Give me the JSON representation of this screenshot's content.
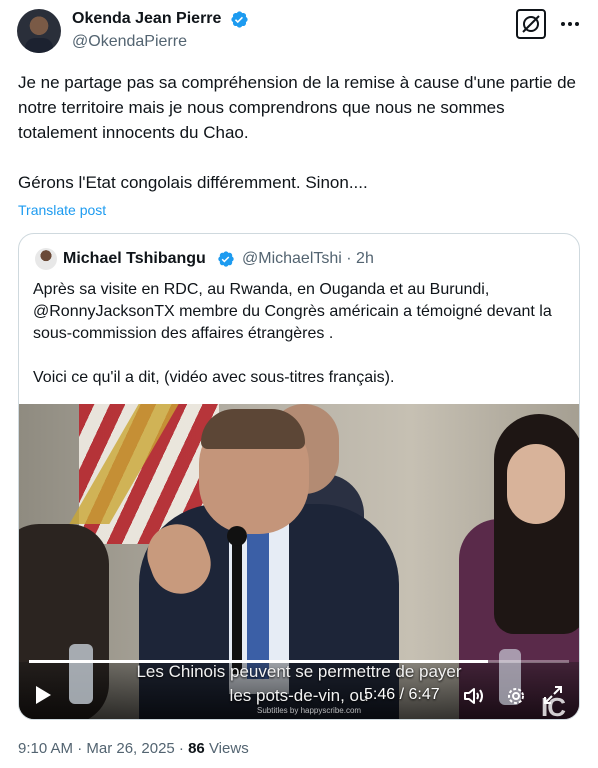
{
  "author": {
    "name": "Okenda Jean Pierre",
    "handle": "@OkendaPierre"
  },
  "post": {
    "text": "Je ne partage pas sa compréhension de la remise à cause d'une partie de notre territoire mais je nous comprendrons que nous ne sommes totalement innocents du Chao.\n\nGérons l'Etat congolais différemment. Sinon....",
    "translate_label": "Translate post"
  },
  "quote": {
    "author_name": "Michael Tshibangu",
    "handle_time": "@MichaelTshi · 2h",
    "text": "Après sa visite en RDC, au Rwanda, en Ouganda et au Burundi, @RonnyJacksonTX  membre du Congrès américain a témoigné devant la sous-commission des affaires étrangères .\n\nVoici ce qu'il a dit, (vidéo avec sous-titres français).",
    "video": {
      "subtitle_line1": "Les Chinois peuvent se permettre de payer",
      "subtitle_line2": "les pots-de-vin, ou",
      "time": "5:46 / 6:47",
      "progress_fraction": 0.85,
      "watermark": "Subtitles by happyscribe.com",
      "logo": "IC"
    }
  },
  "meta": {
    "timestamp": "9:10 AM · Mar 26, 2025 · ",
    "views_count": "86",
    "views_label": " Views"
  },
  "icons": {
    "verified_color": "#1d9bf0",
    "link_color": "#1d9bf0"
  }
}
